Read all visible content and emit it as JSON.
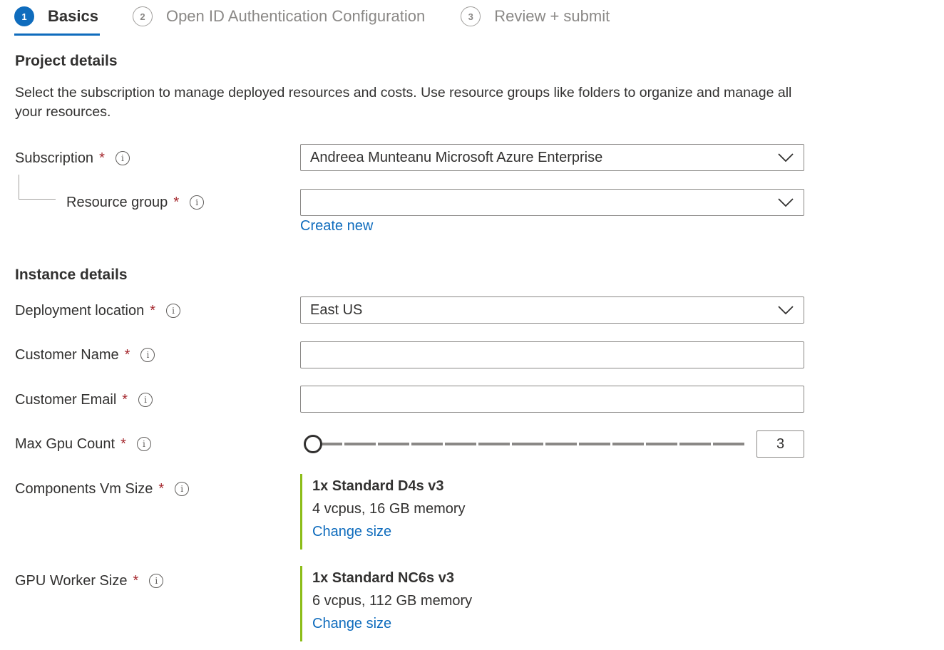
{
  "tabs": [
    {
      "number": "1",
      "label": "Basics"
    },
    {
      "number": "2",
      "label": "Open ID Authentication Configuration"
    },
    {
      "number": "3",
      "label": "Review + submit"
    }
  ],
  "project": {
    "title": "Project details",
    "description": "Select the subscription to manage deployed resources and costs. Use resource groups like folders to organize and manage all your resources.",
    "subscription": {
      "label": "Subscription",
      "value": "Andreea Munteanu Microsoft Azure Enterprise"
    },
    "resource_group": {
      "label": "Resource group",
      "value": "",
      "create_new": "Create new"
    }
  },
  "instance": {
    "title": "Instance details",
    "deployment_location": {
      "label": "Deployment location",
      "value": "East US"
    },
    "customer_name": {
      "label": "Customer Name",
      "value": ""
    },
    "customer_email": {
      "label": "Customer Email",
      "value": ""
    },
    "max_gpu_count": {
      "label": "Max Gpu Count",
      "value": "3",
      "slider_fraction": 0.0
    },
    "components_vm_size": {
      "label": "Components Vm Size",
      "title": "1x Standard D4s v3",
      "spec": "4 vcpus, 16 GB memory",
      "change": "Change size"
    },
    "gpu_worker_size": {
      "label": "GPU Worker Size",
      "title": "1x Standard NC6s v3",
      "spec": "6 vcpus, 112 GB memory",
      "change": "Change size"
    }
  },
  "required_marker": "*",
  "info_glyph": "i",
  "colors": {
    "accent": "#0f6cbd",
    "required": "#a4262c",
    "size_bar": "#8cbd18"
  }
}
